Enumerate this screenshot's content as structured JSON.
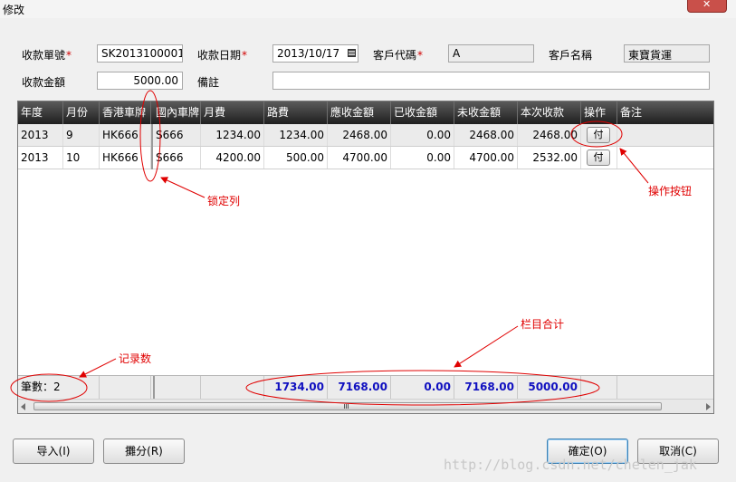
{
  "window": {
    "title": "修改"
  },
  "form": {
    "receipt_no_label": "收款單號",
    "receipt_no_value": "SK2013100001",
    "receipt_date_label": "收款日期",
    "receipt_date_value": "2013/10/17",
    "customer_code_label": "客戶代碼",
    "customer_code_value": "A",
    "customer_name_label": "客戶名稱",
    "customer_name_value": "東寶貨運",
    "amount_label": "收款金額",
    "amount_value": "5000.00",
    "remark_label": "備註",
    "remark_value": "",
    "required_mark": "*"
  },
  "grid": {
    "columns": [
      "年度",
      "月份",
      "香港車牌",
      "國內車牌",
      "月費",
      "路費",
      "應收金額",
      "已收金額",
      "未收金額",
      "本次收款",
      "操作",
      "备注"
    ],
    "rows": [
      {
        "year": "2013",
        "month": "9",
        "hk_plate": "HK666",
        "cn_plate": "S666",
        "monthly_fee": "1234.00",
        "toll": "1234.00",
        "receivable": "2468.00",
        "received": "0.00",
        "outstanding": "2468.00",
        "this_payment": "2468.00",
        "action": "付",
        "note": ""
      },
      {
        "year": "2013",
        "month": "10",
        "hk_plate": "HK666",
        "cn_plate": "S666",
        "monthly_fee": "4200.00",
        "toll": "500.00",
        "receivable": "4700.00",
        "received": "0.00",
        "outstanding": "4700.00",
        "this_payment": "2532.00",
        "action": "付",
        "note": ""
      }
    ],
    "footer": {
      "count_text": "筆數：2",
      "toll_total": "1734.00",
      "receivable_total": "7168.00",
      "received_total": "0.00",
      "outstanding_total": "7168.00",
      "this_payment_total": "5000.00"
    }
  },
  "annotations": {
    "locked_column": "锁定列",
    "action_button": "操作按钮",
    "column_totals": "栏目合计",
    "record_count": "记录数"
  },
  "buttons": {
    "import": "导入(I)",
    "split": "攤分(R)",
    "ok": "確定(O)",
    "cancel": "取消(C)"
  },
  "watermark": "http://blog.csdn.net/chelen_jak",
  "colors": {
    "totals_text": "#1010c0",
    "annotation": "#e00000",
    "header_bg": "#2a2a2a"
  }
}
